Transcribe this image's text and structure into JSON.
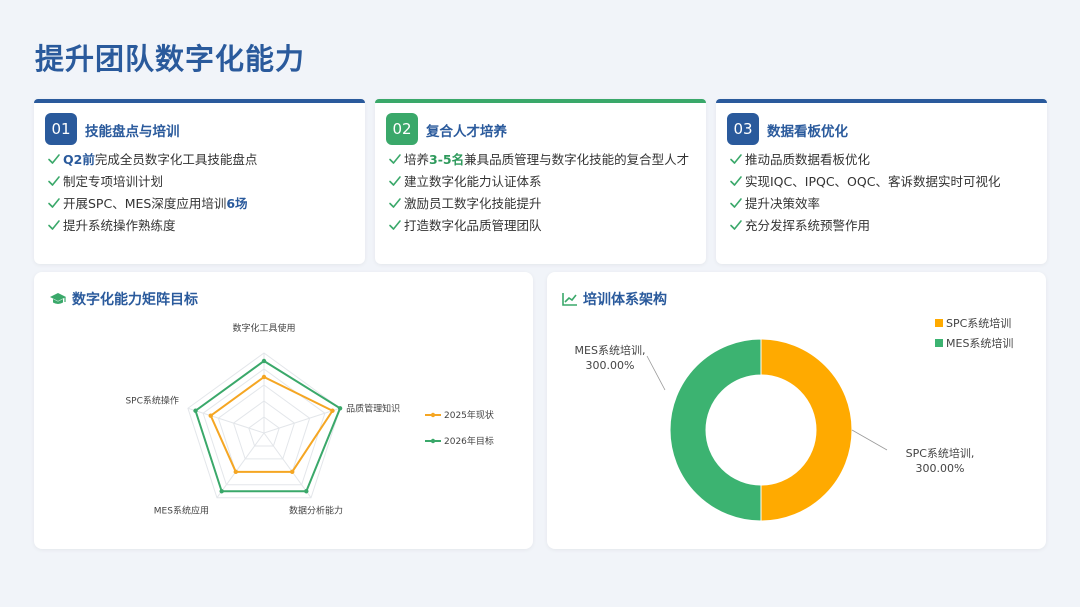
{
  "page": {
    "title": "提升团队数字化能力"
  },
  "cards": [
    {
      "num": "01",
      "title": "技能盘点与培训",
      "color": "#2a5a9c",
      "items": [
        [
          {
            "t": "Q2前",
            "hl": "blue"
          },
          {
            "t": "完成全员数字化工具技能盘点"
          }
        ],
        [
          {
            "t": "制定专项培训计划"
          }
        ],
        [
          {
            "t": "开展SPC、MES深度应用培训"
          },
          {
            "t": "6场",
            "hl": "blue"
          }
        ],
        [
          {
            "t": "提升系统操作熟练度"
          }
        ]
      ]
    },
    {
      "num": "02",
      "title": "复合人才培养",
      "color": "#3aa86a",
      "items": [
        [
          {
            "t": "培养"
          },
          {
            "t": "3-5名",
            "hl": "green"
          },
          {
            "t": "兼具品质管理与数字化技能的复合型人才"
          }
        ],
        [
          {
            "t": "建立数字化能力认证体系"
          }
        ],
        [
          {
            "t": "激励员工数字化技能提升"
          }
        ],
        [
          {
            "t": "打造数字化品质管理团队"
          }
        ]
      ]
    },
    {
      "num": "03",
      "title": "数据看板优化",
      "color": "#2a5a9c",
      "items": [
        [
          {
            "t": "推动品质数据看板优化"
          }
        ],
        [
          {
            "t": "实现IQC、IPQC、OQC、客诉数据实时可视化"
          }
        ],
        [
          {
            "t": "提升决策效率"
          }
        ],
        [
          {
            "t": "充分发挥系统预警作用"
          }
        ]
      ]
    }
  ],
  "radar_panel": {
    "title": "数字化能力矩阵目标",
    "icon": "graduation-cap-icon"
  },
  "donut_panel": {
    "title": "培训体系架构",
    "icon": "line-chart-icon"
  },
  "chart_data": [
    {
      "type": "radar",
      "categories": [
        "数字化工具使用",
        "品质管理知识",
        "数据分析能力",
        "MES系统应用",
        "SPC系统操作"
      ],
      "max": 5,
      "series": [
        {
          "name": "2025年现状",
          "values": [
            3.5,
            4.5,
            3.0,
            3.0,
            3.5
          ],
          "color": "#f5a623"
        },
        {
          "name": "2026年目标",
          "values": [
            4.5,
            5.0,
            4.5,
            4.5,
            4.5
          ],
          "color": "#3aa86a"
        }
      ],
      "grid_color": "#e3e6ea",
      "legend": "right"
    },
    {
      "type": "pie",
      "donut": true,
      "slices": [
        {
          "name": "SPC系统培训",
          "value": 300,
          "label": "SPC系统培训,\n300.00%",
          "color": "#ffaa00"
        },
        {
          "name": "MES系统培训",
          "value": 300,
          "label": "MES系统培训,\n300.00%",
          "color": "#3cb371"
        }
      ],
      "legend": "top-right"
    }
  ]
}
